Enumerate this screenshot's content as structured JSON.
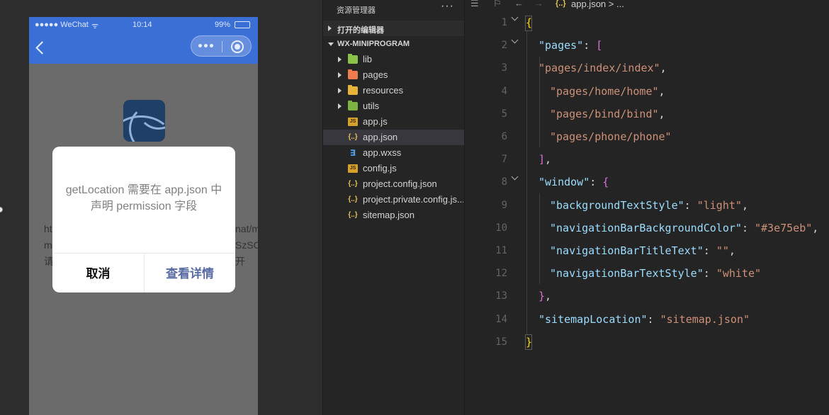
{
  "simulator": {
    "status_bar": {
      "carrier": "●●●●● WeChat",
      "wifi": "ᯤ",
      "time": "10:14",
      "battery": "99%"
    },
    "background_text": {
      "line1_left": "ht",
      "line1_right": "nat/m",
      "line2_left": "m",
      "line2_right": "SzSC",
      "line3_left": "请",
      "line3_right": "开"
    },
    "modal": {
      "message": "getLocation 需要在 app.json 中声明 permission 字段",
      "cancel_label": "取消",
      "confirm_label": "查看详情"
    }
  },
  "explorer": {
    "title": "资源管理器",
    "more_label": "···",
    "open_editors_label": "打开的编辑器",
    "project_label": "WX-MINIPROGRAM",
    "items": [
      {
        "name": "lib",
        "kind": "folder",
        "color": "#8bc34a"
      },
      {
        "name": "pages",
        "kind": "folder",
        "color": "#f07b4f"
      },
      {
        "name": "resources",
        "kind": "folder",
        "color": "#e8b339"
      },
      {
        "name": "utils",
        "kind": "folder",
        "color": "#7cb342"
      },
      {
        "name": "app.js",
        "kind": "js"
      },
      {
        "name": "app.json",
        "kind": "json",
        "selected": true
      },
      {
        "name": "app.wxss",
        "kind": "css"
      },
      {
        "name": "config.js",
        "kind": "js"
      },
      {
        "name": "project.config.json",
        "kind": "json"
      },
      {
        "name": "project.private.config.js...",
        "kind": "json"
      },
      {
        "name": "sitemap.json",
        "kind": "json"
      }
    ],
    "js_badge": "JS",
    "json_badge": "{..}",
    "css_badge": "∃"
  },
  "editor": {
    "breadcrumb": {
      "file_icon": "{..}",
      "file": "app.json",
      "separator": "> ..."
    },
    "lines": [
      {
        "n": "1",
        "fold": true
      },
      {
        "n": "2",
        "fold": true,
        "key": "\"pages\"",
        "colon": ": ",
        "open": "["
      },
      {
        "n": "3",
        "str": "\"pages/index/index\"",
        "comma": ","
      },
      {
        "n": "4",
        "str": "\"pages/home/home\"",
        "comma": ","
      },
      {
        "n": "5",
        "str": "\"pages/bind/bind\"",
        "comma": ","
      },
      {
        "n": "6",
        "str": "\"pages/phone/phone\""
      },
      {
        "n": "7",
        "close": "]",
        "comma": ","
      },
      {
        "n": "8",
        "fold": true,
        "key": "\"window\"",
        "colon": ": ",
        "open": "{"
      },
      {
        "n": "9",
        "key": "\"backgroundTextStyle\"",
        "colon": ": ",
        "str": "\"light\"",
        "comma": ","
      },
      {
        "n": "10",
        "key": "\"navigationBarBackgroundColor\"",
        "colon": ": ",
        "str": "\"#3e75eb\"",
        "comma": ","
      },
      {
        "n": "11",
        "key": "\"navigationBarTitleText\"",
        "colon": ": ",
        "str": "\"\"",
        "comma": ","
      },
      {
        "n": "12",
        "key": "\"navigationBarTextStyle\"",
        "colon": ": ",
        "str": "\"white\""
      },
      {
        "n": "13",
        "close": "}",
        "comma": ","
      },
      {
        "n": "14",
        "key": "\"sitemapLocation\"",
        "colon": ": ",
        "str": "\"sitemap.json\""
      },
      {
        "n": "15"
      }
    ],
    "root_open": "{",
    "root_close": "}"
  }
}
